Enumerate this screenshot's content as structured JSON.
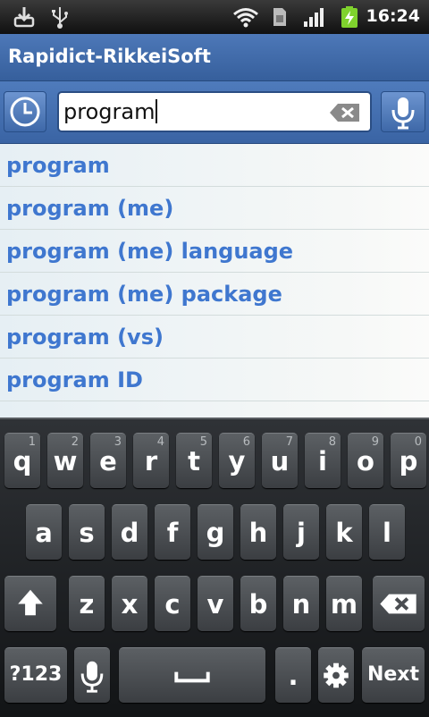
{
  "status_bar": {
    "time": "16:24",
    "left_icons": [
      "download-icon",
      "usb-icon"
    ],
    "right_icons": [
      "wifi-icon",
      "sim-icon",
      "signal-icon",
      "battery-charging-icon"
    ]
  },
  "app": {
    "title": "Rapidict-RikkeiSoft"
  },
  "search": {
    "value": "program",
    "buttons": [
      "history-clock-icon",
      "clear-backspace-icon",
      "microphone-icon"
    ]
  },
  "suggestions": [
    "program",
    "program (me)",
    "program (me) language",
    "program (me) package",
    "program (vs)",
    "program ID"
  ],
  "keyboard": {
    "row1": [
      {
        "key": "q",
        "hint": "1"
      },
      {
        "key": "w",
        "hint": "2"
      },
      {
        "key": "e",
        "hint": "3"
      },
      {
        "key": "r",
        "hint": "4"
      },
      {
        "key": "t",
        "hint": "5"
      },
      {
        "key": "y",
        "hint": "6"
      },
      {
        "key": "u",
        "hint": "7"
      },
      {
        "key": "i",
        "hint": "8"
      },
      {
        "key": "o",
        "hint": "9"
      },
      {
        "key": "p",
        "hint": "0"
      }
    ],
    "row2": [
      "a",
      "s",
      "d",
      "f",
      "g",
      "h",
      "j",
      "k",
      "l"
    ],
    "row3": [
      "z",
      "x",
      "c",
      "v",
      "b",
      "n",
      "m"
    ],
    "symbols_label": "?123",
    "period_label": ".",
    "next_label": "Next",
    "accent_color": "#3f77cf"
  }
}
